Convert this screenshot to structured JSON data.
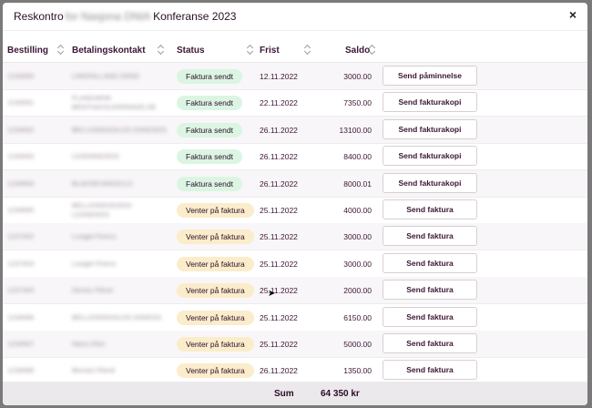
{
  "dialog": {
    "title_prefix": "Reskontro",
    "title_redacted": "for Nasjona DNIA",
    "title_suffix": "Konferanse 2023",
    "close_glyph": "×"
  },
  "columns": {
    "bestilling": "Bestilling",
    "kontakt": "Betalingskontakt",
    "status": "Status",
    "frist": "Frist",
    "saldo": "Saldo"
  },
  "colors": {
    "sent_badge": "#dcf5e3",
    "waiting_badge": "#fbeccb"
  },
  "rows": [
    {
      "order": "1234560",
      "contact": [
        "LINDPALLAND DRNS"
      ],
      "status": "Faktura sendt",
      "kind": "sent",
      "frist": "12.11.2022",
      "saldo": "3000.00",
      "action": "Send påminnelse"
    },
    {
      "order": "1234561",
      "contact": [
        "FLANDAEMI",
        "BENTHAVSLERINNGELSE"
      ],
      "status": "Faktura sendt",
      "kind": "sent",
      "frist": "22.11.2022",
      "saldo": "7350.00",
      "action": "Send fakturakopi"
    },
    {
      "order": "1234562",
      "contact": [
        "BELLDSNDGSLDS DSNDSDS"
      ],
      "status": "Faktura sendt",
      "kind": "sent",
      "frist": "26.11.2022",
      "saldo": "13100.00",
      "action": "Send fakturakopi"
    },
    {
      "order": "1234563",
      "contact": [
        "LDSDNNDSDS"
      ],
      "status": "Faktura sendt",
      "kind": "sent",
      "frist": "26.11.2022",
      "saldo": "8400.00",
      "action": "Send fakturakopi"
    },
    {
      "order": "1234564",
      "contact": [
        "BLADSEIJNDSCLD"
      ],
      "status": "Faktura sendt",
      "kind": "sent",
      "frist": "26.11.2022",
      "saldo": "8000.01",
      "action": "Send fakturakopi"
    },
    {
      "order": "1234565",
      "contact": [
        "BELLDSNDSDSDS",
        "LDSNDSDS"
      ],
      "status": "Venter på faktura",
      "kind": "waiting",
      "frist": "25.11.2022",
      "saldo": "4000.00",
      "action": "Send faktura"
    },
    {
      "order": "1237402",
      "contact": [
        "Lusiget Fivens"
      ],
      "status": "Venter på faktura",
      "kind": "waiting",
      "frist": "25.11.2022",
      "saldo": "3000.00",
      "action": "Send faktura"
    },
    {
      "order": "1237403",
      "contact": [
        "Lusiget Fivens"
      ],
      "status": "Venter på faktura",
      "kind": "waiting",
      "frist": "25.11.2022",
      "saldo": "3000.00",
      "action": "Send faktura"
    },
    {
      "order": "1237404",
      "contact": [
        "Deniss Filsne"
      ],
      "status": "Venter på faktura",
      "kind": "waiting",
      "frist": "25.11.2022",
      "saldo": "2000.00",
      "action": "Send faktura"
    },
    {
      "order": "1234566",
      "contact": [
        "BELLDSNDGSLDS DSNDSS"
      ],
      "status": "Venter på faktura",
      "kind": "waiting",
      "frist": "25.11.2022",
      "saldo": "6150.00",
      "action": "Send faktura"
    },
    {
      "order": "1234567",
      "contact": [
        "Nasrs Elen"
      ],
      "status": "Venter på faktura",
      "kind": "waiting",
      "frist": "25.11.2022",
      "saldo": "5000.00",
      "action": "Send faktura"
    },
    {
      "order": "1234568",
      "contact": [
        "Benses Filsnd"
      ],
      "status": "Venter på faktura",
      "kind": "waiting",
      "frist": "26.11.2022",
      "saldo": "1350.00",
      "action": "Send faktura"
    }
  ],
  "footer": {
    "sum_label": "Sum",
    "sum_value": "64 350 kr"
  }
}
